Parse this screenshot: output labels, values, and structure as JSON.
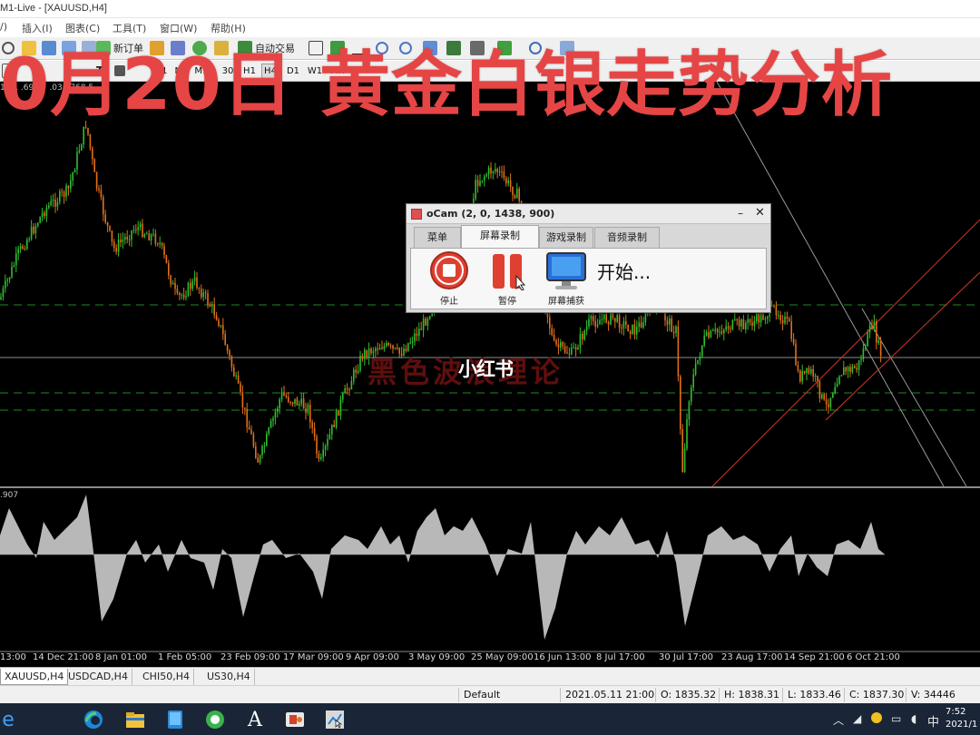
{
  "window": {
    "title": "M1-Live - [XAUUSD,H4]"
  },
  "menu": [
    "/)",
    "插入(I)",
    "图表(C)",
    "工具(T)",
    "窗口(W)",
    "帮助(H)"
  ],
  "toolbar": {
    "new_order": "新订单",
    "auto_trade": "自动交易",
    "timeframes": [
      "M1",
      "M5",
      "M15",
      "30",
      "H1",
      "H4",
      "D1",
      "W1",
      "MN"
    ],
    "selected_timeframe": "H4"
  },
  "overlay": {
    "headline": "0月20日 黄金白银走势分析",
    "watermark_cn": "黑色波浪理论",
    "watermark_logo": "小红书"
  },
  "chart": {
    "price_readout": "17 1 .69 17 .03 1768.5",
    "osc_label": ".907",
    "x_labels": [
      "13:00",
      "14 Dec 21:00",
      "8 Jan 01:00",
      "1 Feb 05:00",
      "23 Feb 09:00",
      "17 Mar 09:00",
      "9 Apr 09:00",
      "3 May 09:00",
      "25 May 09:00",
      "16 Jun 13:00",
      "8 Jul 17:00",
      "30 Jul 17:00",
      "23 Aug 17:00",
      "14 Sep 21:00",
      "6 Oct 21:00"
    ]
  },
  "ocam": {
    "title": "oCam (2, 0, 1438, 900)",
    "tabs": [
      "菜单",
      "屏幕录制",
      "游戏录制",
      "音频录制"
    ],
    "active_tab": "屏幕录制",
    "buttons": {
      "stop": "停止",
      "pause": "暂停",
      "capture": "屏幕捕获"
    },
    "start_text": "开始..."
  },
  "symbol_tabs": [
    "XAUUSD,H4",
    "USDCAD,H4",
    "CHI50,H4",
    "US30,H4"
  ],
  "status": {
    "profile": "Default",
    "datetime": "2021.05.11 21:00",
    "open": "O: 1835.32",
    "high": "H: 1838.31",
    "low": "L: 1833.46",
    "close": "C: 1837.30",
    "volume": "V: 34446"
  },
  "taskbar": {
    "ime": "中",
    "time": "7:52",
    "date": "2021/1"
  },
  "colors": {
    "headline": "#e64545",
    "candle_up": "#2fbf2f",
    "candle_down": "#e0701a",
    "channel": "#c83a28",
    "hist": "#b8b8b8"
  }
}
